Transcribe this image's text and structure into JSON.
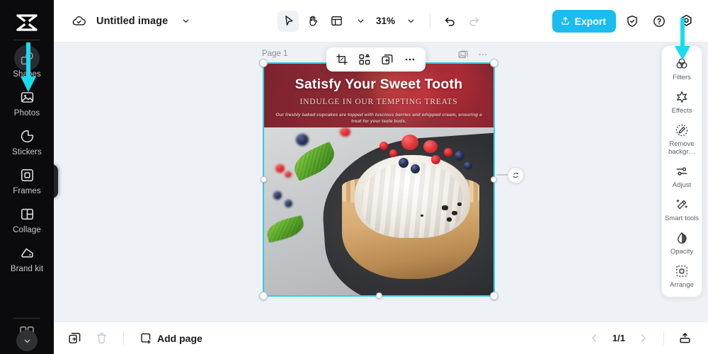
{
  "app": {
    "name": "image-editor",
    "accent_cyan": "#30cfe8",
    "export_blue": "#19bdf0",
    "canvas_bg": "#eef1f5",
    "rail_bg": "#0b0b0d"
  },
  "left_rail": {
    "logo_icon": "app-logo-icon",
    "items": [
      {
        "label": "Shapes",
        "icon": "shapes-icon",
        "state": "hovered"
      },
      {
        "label": "Photos",
        "icon": "photos-icon",
        "state": "default"
      },
      {
        "label": "Stickers",
        "icon": "stickers-icon",
        "state": "default"
      },
      {
        "label": "Frames",
        "icon": "frames-icon",
        "state": "default"
      },
      {
        "label": "Collage",
        "icon": "collage-icon",
        "state": "default"
      },
      {
        "label": "Brand kit",
        "icon": "brand-kit-icon",
        "state": "default"
      }
    ],
    "collapse_icon": "chevron-down-icon",
    "panel_tab_icon": "chevron-right-icon"
  },
  "topbar": {
    "cloud_icon": "cloud-saved-icon",
    "title": "Untitled image",
    "title_caret_icon": "chevron-down-icon",
    "tools": [
      {
        "name": "select-tool",
        "icon": "cursor-arrow-icon",
        "active": true
      },
      {
        "name": "hand-tool",
        "icon": "hand-icon",
        "active": false
      },
      {
        "name": "layout-tool",
        "icon": "layout-icon",
        "active": false
      }
    ],
    "layout_caret_icon": "chevron-down-icon",
    "zoom_value": "31%",
    "zoom_caret_icon": "chevron-down-icon",
    "undo_icon": "undo-icon",
    "redo_icon": "redo-icon",
    "export_label": "Export",
    "export_icon": "export-upload-icon",
    "shield_icon": "shield-check-icon",
    "help_icon": "help-circle-icon",
    "settings_icon": "settings-gear-icon"
  },
  "canvas": {
    "page_label": "Page 1",
    "object_toolbar": [
      {
        "name": "crop-button",
        "icon": "crop-icon"
      },
      {
        "name": "cutout-button",
        "icon": "cutout-icon"
      },
      {
        "name": "duplicate-button",
        "icon": "duplicate-icon"
      },
      {
        "name": "more-button",
        "icon": "more-dots-icon"
      }
    ],
    "corner_tools": [
      {
        "name": "replace-image-button",
        "icon": "replace-image-icon"
      },
      {
        "name": "page-more-button",
        "icon": "more-dots-icon"
      }
    ],
    "rotate_icon": "rotate-icon",
    "selected_object": "poster-image"
  },
  "poster": {
    "title": "Satisfy Your Sweet Tooth",
    "subtitle": "INDULGE IN OUR TEMPTING TREATS",
    "body": "Our freshly baked cupcakes are topped with luscious berries and whipped cream, ensuring a treat for your taste buds.",
    "banner_color": "#8b2a33"
  },
  "right_panel": {
    "items": [
      {
        "label": "Filters",
        "icon": "filters-icon"
      },
      {
        "label": "Effects",
        "icon": "effects-icon"
      },
      {
        "label": "Remove backgr…",
        "icon": "remove-background-icon"
      },
      {
        "label": "Adjust",
        "icon": "adjust-icon"
      },
      {
        "label": "Smart tools",
        "icon": "smart-tools-icon"
      },
      {
        "label": "Opacity",
        "icon": "opacity-icon"
      },
      {
        "label": "Arrange",
        "icon": "arrange-icon"
      }
    ]
  },
  "bottombar": {
    "duplicate_page_icon": "duplicate-page-icon",
    "delete_page_icon": "trash-icon",
    "add_page_label": "Add page",
    "add_page_icon": "add-page-icon",
    "prev_icon": "chevron-left-icon",
    "page_indicator": "1/1",
    "next_icon": "chevron-right-icon",
    "present_icon": "present-icon"
  },
  "annotations": [
    {
      "name": "arrow-to-shapes",
      "color": "#17dcef"
    },
    {
      "name": "arrow-to-filters",
      "color": "#17dcef"
    }
  ]
}
